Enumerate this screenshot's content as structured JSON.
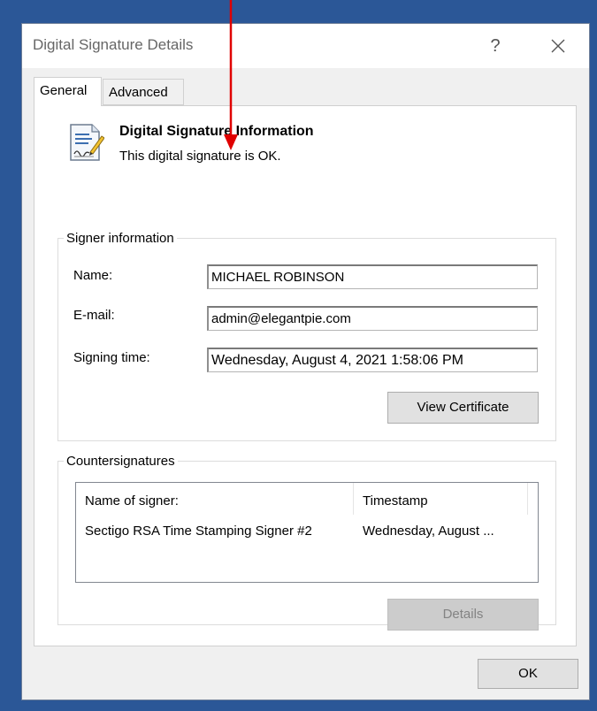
{
  "window": {
    "title": "Digital Signature Details",
    "help_label": "?"
  },
  "tabs": [
    {
      "label": "General",
      "active": true
    },
    {
      "label": "Advanced",
      "active": false
    }
  ],
  "info": {
    "title": "Digital Signature Information",
    "status": "This digital signature is OK."
  },
  "signer": {
    "legend": "Signer information",
    "name_label": "Name:",
    "name_value": "MICHAEL ROBINSON",
    "email_label": "E-mail:",
    "email_value": "admin@elegantpie.com",
    "time_label": "Signing time:",
    "time_value": "Wednesday, August 4, 2021 1:58:06 PM",
    "view_cert_label": "View Certificate"
  },
  "countersignatures": {
    "legend": "Countersignatures",
    "columns": [
      "Name of signer:",
      "Timestamp"
    ],
    "rows": [
      [
        "Sectigo RSA Time Stamping Signer #2",
        "Wednesday, August ..."
      ]
    ],
    "details_label": "Details"
  },
  "footer": {
    "ok_label": "OK"
  },
  "colors": {
    "desktop": "#2b5797",
    "dialog": "#f0f0f0",
    "annotation_arrow": "#e00000"
  },
  "icons": {
    "close": "close-icon",
    "certificate": "certificate-icon",
    "annotation": "red-arrow-icon"
  }
}
